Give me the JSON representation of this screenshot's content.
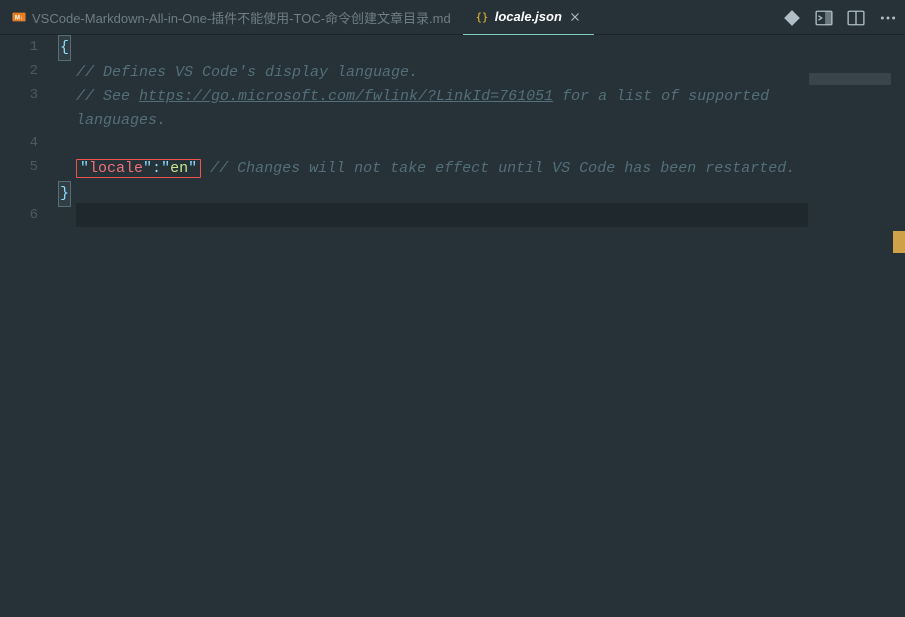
{
  "tabs": [
    {
      "label": "VSCode-Markdown-All-in-One-插件不能使用-TOC-命令创建文章目录.md",
      "icon": "markdown",
      "active": false
    },
    {
      "label": "locale.json",
      "icon": "json",
      "active": true
    }
  ],
  "titlebar": {
    "diff_icon": "open-changes-icon",
    "split_icon": "split-editor-icon",
    "layout_icon": "toggle-layout-icon",
    "more_icon": "more-icon"
  },
  "gutter": {
    "lines": [
      "1",
      "2",
      "3",
      "4",
      "5",
      "6"
    ]
  },
  "code": {
    "l1_brace": "{",
    "l2_comment": "// Defines VS Code's display language.",
    "l3_comment_pre": "// See ",
    "l3_link": "https://go.microsoft.com/fwlink/?LinkId=761051",
    "l3_comment_post": " for a list of supported languages.",
    "l5_quote": "\"",
    "l5_key": "locale",
    "l5_colon": ":",
    "l5_val": "en",
    "l5_comment": "// Changes will not take effect until VS Code has been restarted.",
    "l6_brace": "}"
  }
}
